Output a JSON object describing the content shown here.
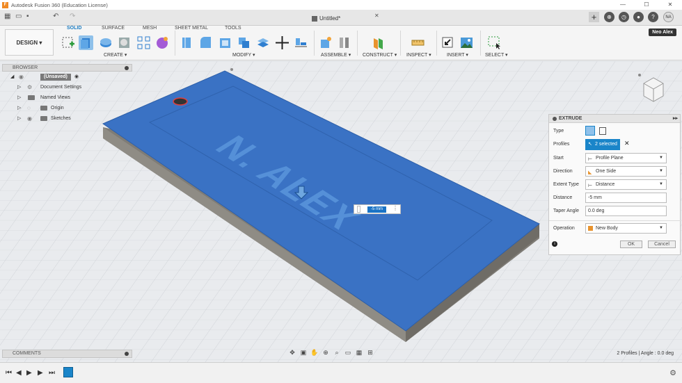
{
  "window": {
    "title": "Autodesk Fusion 360 (Education License)",
    "doc_tab": "Untitled*"
  },
  "user": {
    "initials": "NA",
    "name": "Neo Alex"
  },
  "ribbon": {
    "workspace": "DESIGN",
    "tabs": [
      "SOLID",
      "SURFACE",
      "MESH",
      "SHEET METAL",
      "TOOLS"
    ],
    "groups": [
      "CREATE",
      "MODIFY",
      "ASSEMBLE",
      "CONSTRUCT",
      "INSPECT",
      "INSERT",
      "SELECT"
    ]
  },
  "browser": {
    "title": "BROWSER",
    "items": [
      {
        "label": "(Unsaved)"
      },
      {
        "label": "Document Settings"
      },
      {
        "label": "Named Views"
      },
      {
        "label": "Origin"
      },
      {
        "label": "Sketches"
      }
    ]
  },
  "viewport": {
    "engraved_text": "N. ALEX",
    "inline_value": "-5 mm"
  },
  "extrude": {
    "title": "EXTRUDE",
    "fields": {
      "type": "Type",
      "profiles": "Profiles",
      "profiles_value": "2 selected",
      "start": "Start",
      "start_value": "Profile Plane",
      "direction": "Direction",
      "direction_value": "One Side",
      "extent_type": "Extent Type",
      "extent_value": "Distance",
      "distance": "Distance",
      "distance_value": "-5 mm",
      "taper": "Taper Angle",
      "taper_value": "0.0 deg",
      "operation": "Operation",
      "operation_value": "New Body"
    },
    "ok": "OK",
    "cancel": "Cancel"
  },
  "comments": {
    "title": "COMMENTS"
  },
  "status": {
    "text": "2 Profiles | Angle : 0.0 deg"
  },
  "colors": {
    "accent": "#1a85c9",
    "face": "#3a72c4",
    "side": "#8a8780"
  }
}
